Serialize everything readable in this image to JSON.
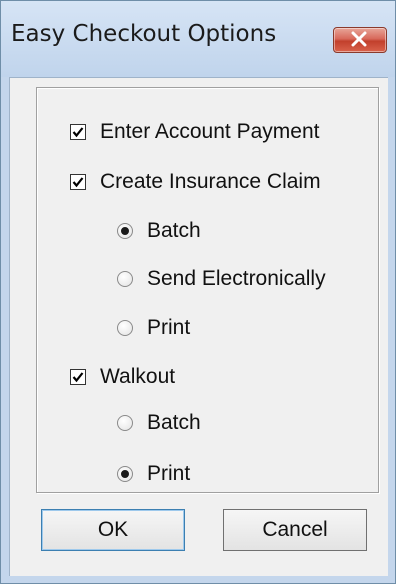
{
  "window": {
    "title": "Easy Checkout Options",
    "close_icon": "close-x-icon"
  },
  "options": {
    "enter_account_payment": {
      "label": "Enter Account Payment",
      "checked": true
    },
    "create_insurance_claim": {
      "label": "Create Insurance Claim",
      "checked": true,
      "radios": [
        {
          "label": "Batch",
          "selected": true
        },
        {
          "label": "Send Electronically",
          "selected": false
        },
        {
          "label": "Print",
          "selected": false
        }
      ]
    },
    "walkout": {
      "label": "Walkout",
      "checked": true,
      "radios": [
        {
          "label": "Batch",
          "selected": false
        },
        {
          "label": "Print",
          "selected": true
        }
      ]
    }
  },
  "buttons": {
    "ok_label": "OK",
    "cancel_label": "Cancel"
  },
  "colors": {
    "frame": "#c4d6ec",
    "close_button": "#c2402c",
    "dialog_bg": "#f0f0f0"
  }
}
